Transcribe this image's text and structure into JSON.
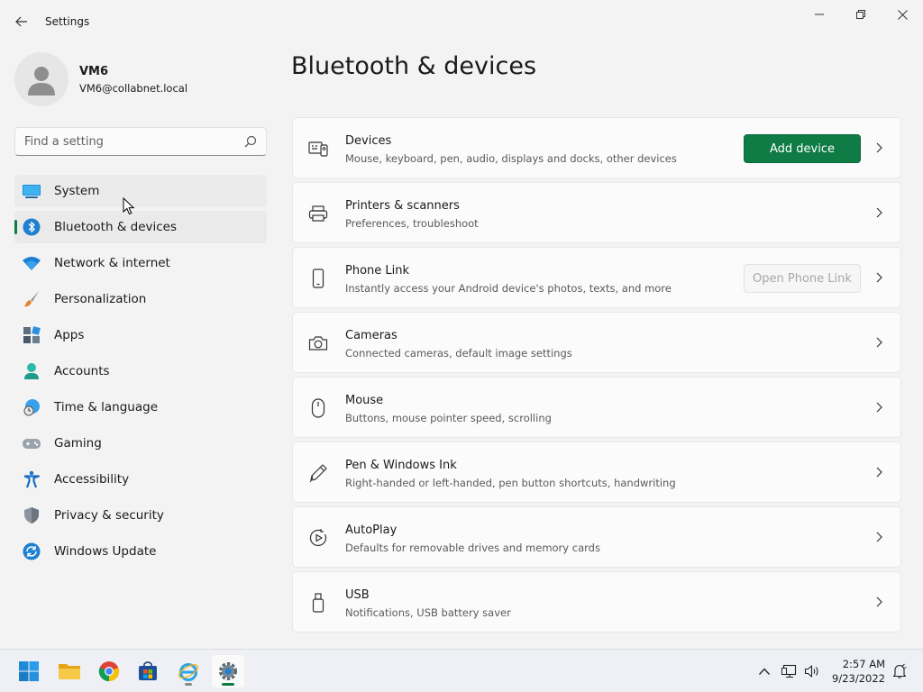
{
  "window": {
    "title": "Settings",
    "back_icon": "back-arrow-icon",
    "controls": [
      "minimize-icon",
      "maximize-icon",
      "close-icon"
    ]
  },
  "profile": {
    "name": "VM6",
    "email": "VM6@collabnet.local"
  },
  "search": {
    "placeholder": "Find a setting",
    "value": ""
  },
  "nav": {
    "items": [
      {
        "label": "System",
        "icon": "system-icon",
        "state": "hover"
      },
      {
        "label": "Bluetooth & devices",
        "icon": "bluetooth-icon",
        "state": "selected"
      },
      {
        "label": "Network & internet",
        "icon": "wifi-icon",
        "state": ""
      },
      {
        "label": "Personalization",
        "icon": "paintbrush-icon",
        "state": ""
      },
      {
        "label": "Apps",
        "icon": "apps-icon",
        "state": ""
      },
      {
        "label": "Accounts",
        "icon": "accounts-icon",
        "state": ""
      },
      {
        "label": "Time & language",
        "icon": "globe-clock-icon",
        "state": ""
      },
      {
        "label": "Gaming",
        "icon": "gamepad-icon",
        "state": ""
      },
      {
        "label": "Accessibility",
        "icon": "accessibility-icon",
        "state": ""
      },
      {
        "label": "Privacy & security",
        "icon": "shield-icon",
        "state": ""
      },
      {
        "label": "Windows Update",
        "icon": "update-icon",
        "state": ""
      }
    ]
  },
  "main": {
    "title": "Bluetooth & devices",
    "cards": [
      {
        "title": "Devices",
        "desc": "Mouse, keyboard, pen, audio, displays and docks, other devices",
        "icon": "devices-icon",
        "button": "Add device"
      },
      {
        "title": "Printers & scanners",
        "desc": "Preferences, troubleshoot",
        "icon": "printer-icon"
      },
      {
        "title": "Phone Link",
        "desc": "Instantly access your Android device's photos, texts, and more",
        "icon": "phone-icon",
        "button": "Open Phone Link",
        "button_disabled": true
      },
      {
        "title": "Cameras",
        "desc": "Connected cameras, default image settings",
        "icon": "camera-icon"
      },
      {
        "title": "Mouse",
        "desc": "Buttons, mouse pointer speed, scrolling",
        "icon": "mouse-icon"
      },
      {
        "title": "Pen & Windows Ink",
        "desc": "Right-handed or left-handed, pen button shortcuts, handwriting",
        "icon": "pen-icon"
      },
      {
        "title": "AutoPlay",
        "desc": "Defaults for removable drives and memory cards",
        "icon": "autoplay-icon"
      },
      {
        "title": "USB",
        "desc": "Notifications, USB battery saver",
        "icon": "usb-icon"
      }
    ]
  },
  "taskbar": {
    "apps": [
      "start-icon",
      "file-explorer-icon",
      "chrome-icon",
      "store-icon",
      "internet-explorer-icon",
      "settings-icon"
    ],
    "active_app": "settings-icon",
    "tray": [
      "chevron-up-icon",
      "network-icon",
      "volume-icon",
      "notification-icon"
    ],
    "time": "2:57 AM",
    "date": "9/23/2022"
  },
  "colors": {
    "accent": "#0f7b45",
    "background": "#f3f3f3",
    "card": "#fbfbfb"
  }
}
